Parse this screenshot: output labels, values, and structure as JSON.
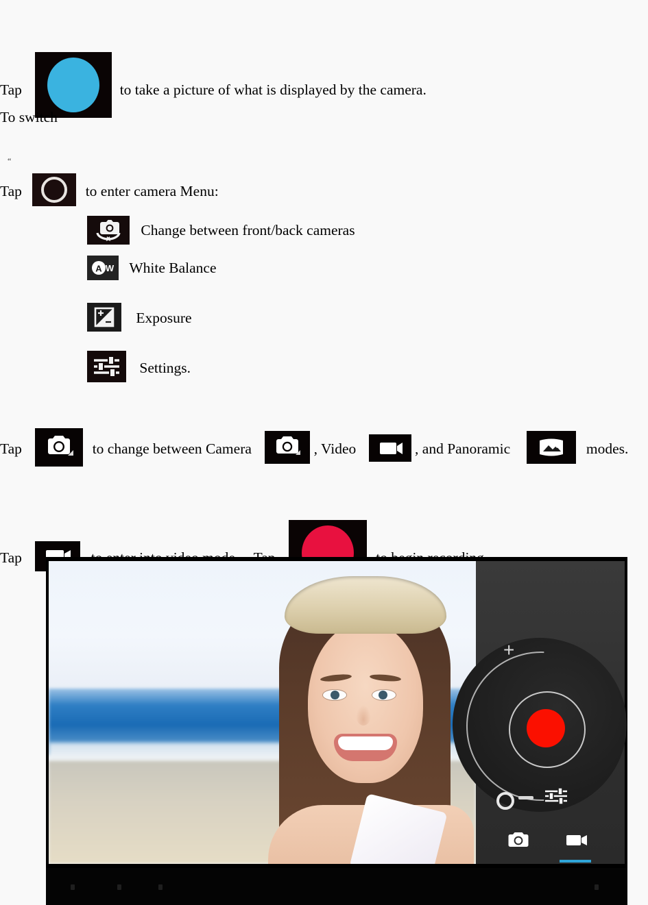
{
  "document": {
    "paragraphs": [
      {
        "id": "shutter-line",
        "pre": "Tap",
        "icon": "shutter-blue-circle-icon",
        "post": "to take a picture of what is displayed by the camera."
      },
      {
        "id": "switch-line",
        "text": "To switch"
      },
      {
        "id": "menu-line",
        "quote": "“",
        "pre": "Tap",
        "icon": "camera-menu-ring-icon",
        "post": "to enter camera Menu:"
      },
      {
        "id": "modes-line",
        "pre": "Tap",
        "icon": "camera-mode-icon",
        "mid1": "to change between Camera",
        "icon2": "camera-mode-icon",
        "mid2": ", Video",
        "icon3": "video-mode-icon",
        "mid3": ", and Panoramic",
        "icon4": "panoramic-mode-icon",
        "post": "modes."
      },
      {
        "id": "record-line",
        "pre": "Tap",
        "icon": "video-mode-icon",
        "mid1": "to enter into video mode.",
        "pre2": "Tap",
        "icon2": "record-red-circle-icon",
        "post": "to begin recording."
      }
    ],
    "menu_items": [
      {
        "icon": "switch-camera-icon",
        "label": "Change between front/back cameras"
      },
      {
        "icon": "white-balance-icon",
        "label": "White Balance"
      },
      {
        "icon": "exposure-icon",
        "label": "Exposure"
      },
      {
        "icon": "settings-sliders-icon",
        "label": "Settings."
      }
    ]
  },
  "screenshot": {
    "name": "camera-app-screenshot",
    "viewfinder": {
      "description": "Beach photo preview: smiling woman wearing a feather headband, blue sea and sand behind her"
    },
    "panel": {
      "record_button": "record-button",
      "zoom_in": "+",
      "zoom_out": "−",
      "zoom_knob": "zoom-slider-knob",
      "settings": "settings-sliders-icon",
      "modes": [
        {
          "icon": "photo-mode-icon",
          "selected": false
        },
        {
          "icon": "video-mode-icon",
          "selected": true
        }
      ]
    },
    "navbar": {
      "items": [
        "back",
        "home",
        "recents",
        "menu"
      ]
    }
  },
  "colors": {
    "page_background": "#f9f9f9",
    "shutter_blue": "#3ab3e0",
    "record_red_doc": "#e8113f",
    "record_red_app": "#fb1000",
    "mode_accent": "#2fa5d8",
    "chip_black": "#0b0505"
  }
}
